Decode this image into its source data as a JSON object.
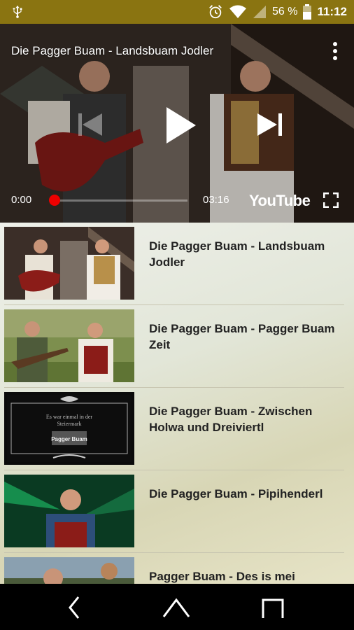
{
  "status_bar": {
    "battery_percent": "56 %",
    "time": "11:12",
    "icons": [
      "usb-icon",
      "alarm-icon",
      "wifi-icon",
      "signal-icon",
      "battery-icon"
    ]
  },
  "player": {
    "title": "Die Pagger Buam - Landsbuam Jodler",
    "current_time": "0:00",
    "duration": "03:16",
    "progress": 0,
    "logo": "YouTube",
    "accent_color": "#ee0000"
  },
  "playlist": [
    {
      "title": "Die Pagger Buam - Landsbuam Jodler"
    },
    {
      "title": "Die Pagger Buam - Pagger Buam Zeit"
    },
    {
      "title": "Die Pagger Buam - Zwischen Holwa und Dreiviertl",
      "thumb_text_line1": "Es war einmal in der",
      "thumb_text_line2": "Steiermark",
      "thumb_logo": "Pagger Buam"
    },
    {
      "title": "Die Pagger Buam - Pipihenderl"
    },
    {
      "title": "Pagger Buam - Des is mei"
    }
  ],
  "nav_bar": {
    "icons": [
      "back-icon",
      "home-icon",
      "recents-icon"
    ]
  }
}
